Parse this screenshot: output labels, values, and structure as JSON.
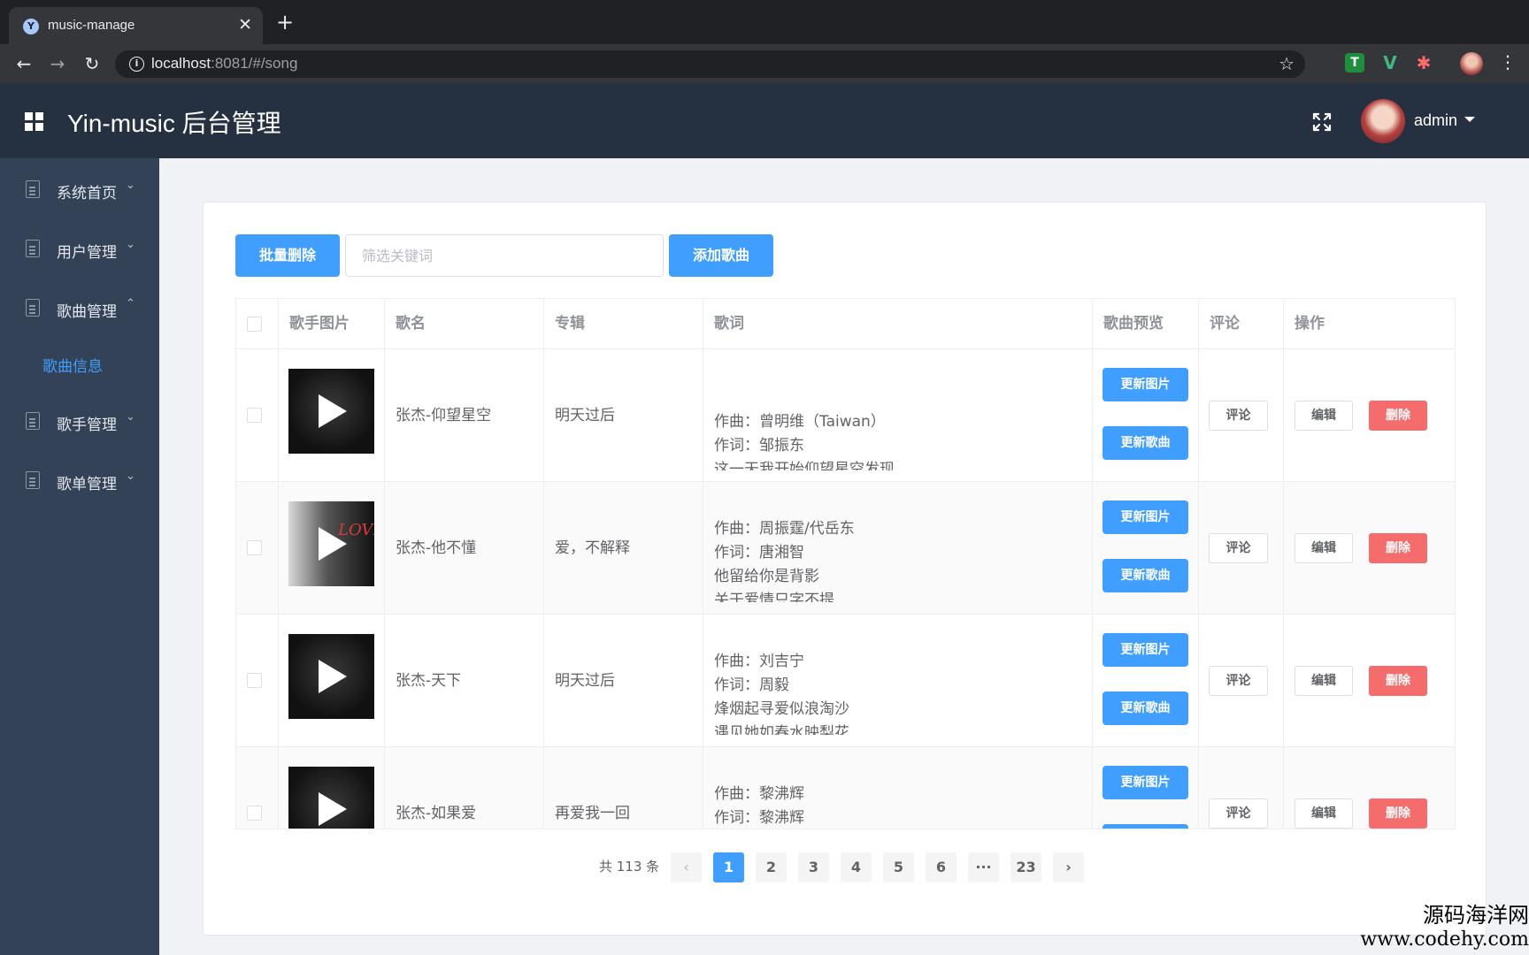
{
  "browser": {
    "tab_title": "music-manage",
    "url_host": "localhost",
    "url_rest": ":8081/#/song"
  },
  "header": {
    "title": "Yin-music 后台管理",
    "username": "admin"
  },
  "sidebar": {
    "items": [
      {
        "label": "系统首页",
        "caret": "⌄"
      },
      {
        "label": "用户管理",
        "caret": "⌄"
      },
      {
        "label": "歌曲管理",
        "caret": "⌃"
      },
      {
        "label": "歌手管理",
        "caret": "⌄"
      },
      {
        "label": "歌单管理",
        "caret": "⌄"
      }
    ],
    "sub_item": "歌曲信息"
  },
  "toolbar": {
    "batch_delete": "批量删除",
    "filter_placeholder": "筛选关键词",
    "add_song": "添加歌曲"
  },
  "table": {
    "headers": [
      "歌手图片",
      "歌名",
      "专辑",
      "歌词",
      "歌曲预览",
      "评论",
      "操作"
    ],
    "rows": [
      {
        "name": "张杰-仰望星空",
        "album": "明天过后",
        "lyrics": [
          "",
          "",
          "作曲：曾明维（Taiwan）",
          "作词：邹振东",
          "这一天我开始仰望星空发现"
        ]
      },
      {
        "name": "张杰-他不懂",
        "album": "爱，不解释",
        "lyrics": [
          "作曲：周振霆/代岳东",
          "作词：唐湘智",
          "他留给你是背影",
          "关于爱情只字不提"
        ]
      },
      {
        "name": "张杰-天下",
        "album": "明天过后",
        "lyrics": [
          "作曲：刘吉宁",
          "作词：周毅",
          "烽烟起寻爱似浪淘沙",
          "遇见她如春水映梨花"
        ]
      },
      {
        "name": "张杰-如果爱",
        "album": "再爱我一回",
        "lyrics": [
          "作曲：黎沸辉",
          "作词：黎沸辉"
        ]
      }
    ],
    "btn_update_pic": "更新图片",
    "btn_update_song": "更新歌曲",
    "btn_comment": "评论",
    "btn_edit": "编辑",
    "btn_delete": "删除",
    "cover_love_text": "LOVE"
  },
  "pagination": {
    "total": "共 113 条",
    "pages": [
      "1",
      "2",
      "3",
      "4",
      "5",
      "6",
      "···",
      "23"
    ],
    "active": "1",
    "prev": "‹",
    "next": "›"
  },
  "watermark": {
    "line1": "源码海洋网",
    "line2": "www.codehy.com"
  },
  "colors": {
    "primary": "#409eff",
    "danger": "#f56c6c",
    "header_bg": "#253041",
    "sidebar_bg": "#334256"
  }
}
